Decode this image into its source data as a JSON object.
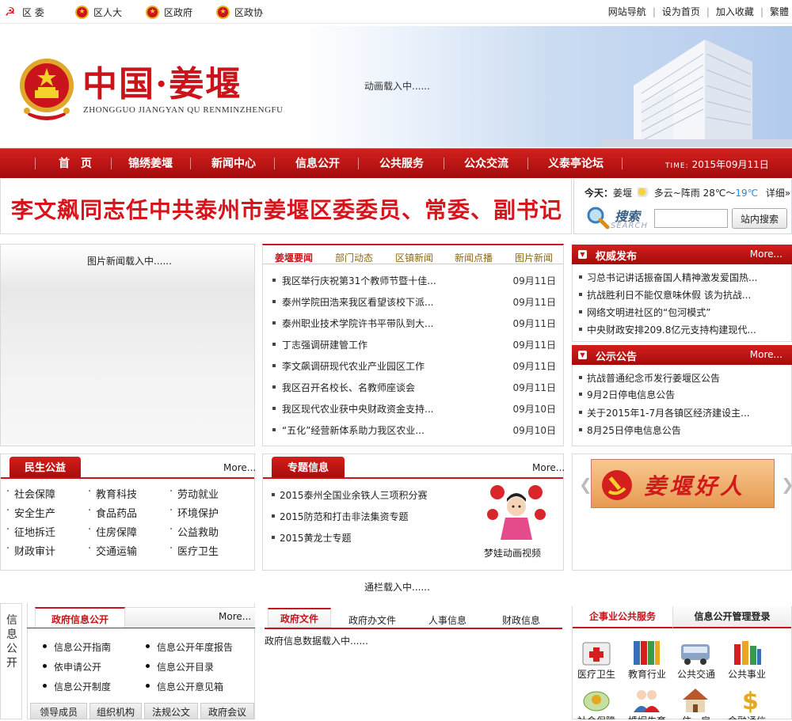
{
  "topbar": {
    "links_left": [
      "区 委",
      "区人大",
      "区政府",
      "区政协"
    ],
    "links_right": [
      "网站导航",
      "设为首页",
      "加入收藏",
      "繁體"
    ]
  },
  "header": {
    "title": "中国·姜堰",
    "subtitle": "ZHONGGUO JIANGYAN QU RENMINZHENGFU",
    "animation_status": "动画载入中......"
  },
  "nav": {
    "items": [
      "首　页",
      "锦绣姜堰",
      "新闻中心",
      "信息公开",
      "公共服务",
      "公众交流",
      "义泰亭论坛"
    ],
    "time_label": "TIME:",
    "time_value": "2015年09月11日"
  },
  "headline": "李文飙同志任中共泰州市姜堰区委委员、常委、副书记",
  "weather": {
    "prefix": "今天：",
    "city": "姜堰",
    "condition": "多云~阵雨",
    "temp_high": "28℃",
    "sep": "～",
    "temp_low": "19℃",
    "detail": "详细»"
  },
  "search": {
    "label": "搜索",
    "label_en": "SEARCH",
    "placeholder": "",
    "button": "站内搜索"
  },
  "photo_news": {
    "status": "图片新闻载入中......"
  },
  "news": {
    "tabs": [
      "姜堰要闻",
      "部门动态",
      "区镇新闻",
      "新闻点播",
      "图片新闻"
    ],
    "items": [
      {
        "title": "我区举行庆祝第31个教师节暨十佳...",
        "date": "09月11日"
      },
      {
        "title": "泰州学院田浩来我区看望该校下派...",
        "date": "09月11日"
      },
      {
        "title": "泰州职业技术学院许书平带队到大...",
        "date": "09月11日"
      },
      {
        "title": "丁志强调研建管工作",
        "date": "09月11日"
      },
      {
        "title": "李文飙调研现代农业产业园区工作",
        "date": "09月11日"
      },
      {
        "title": "我区召开名校长、名教师座谈会",
        "date": "09月11日"
      },
      {
        "title": "我区现代农业获中央财政资金支持...",
        "date": "09月10日"
      },
      {
        "title": "“五化”经营新体系助力我区农业...",
        "date": "09月10日"
      }
    ]
  },
  "authority": {
    "title": "权威发布",
    "more": "More...",
    "items": [
      "习总书记讲话振奋国人精神激发爱国热...",
      "抗战胜利日不能仅意味休假 该为抗战...",
      "网络文明进社区的“包河模式”",
      "中央财政安排209.8亿元支持构建现代..."
    ]
  },
  "notice": {
    "title": "公示公告",
    "more": "More...",
    "items": [
      "抗战普通纪念币发行姜堰区公告",
      "9月2日停电信息公告",
      "关于2015年1-7月各镇区经济建设主...",
      "8月25日停电信息公告"
    ]
  },
  "livelihood": {
    "title": "民生公益",
    "more": "More...",
    "items": [
      "社会保障",
      "教育科技",
      "劳动就业",
      "安全生产",
      "食品药品",
      "环境保护",
      "征地拆迁",
      "住房保障",
      "公益救助",
      "财政审计",
      "交通运输",
      "医疗卫生"
    ]
  },
  "topics": {
    "title": "专题信息",
    "more": "More...",
    "items": [
      "2015泰州全国业余铁人三项积分赛",
      "2015防范和打击非法集资专题",
      "2015黄龙士专题"
    ],
    "video_caption": "梦娃动画视频"
  },
  "good_people": {
    "text": "姜堰好人"
  },
  "banner_status": "通栏载入中......",
  "gov_info": {
    "side_label": "信息公开",
    "tab": "政府信息公开",
    "more": "More...",
    "items": [
      "信息公开指南",
      "信息公开年度报告",
      "依申请公开",
      "信息公开目录",
      "信息公开制度",
      "信息公开意见箱"
    ],
    "bottom_tabs": [
      "领导成员",
      "组织机构",
      "法规公文",
      "政府会议"
    ]
  },
  "gov_docs": {
    "tabs": [
      "政府文件",
      "政府办文件",
      "人事信息",
      "财政信息"
    ],
    "status": "政府信息数据载入中......"
  },
  "services": {
    "tabs": [
      "企事业公共服务",
      "信息公开管理登录"
    ],
    "items": [
      "医疗卫生",
      "教育行业",
      "公共交通",
      "公共事业",
      "社会保障",
      "婚姻生育",
      "住　房",
      "金融通信"
    ]
  },
  "colors": {
    "brand_red": "#c8141a",
    "nav_red": "#b8110f",
    "weather_blue": "#2b8ad6"
  }
}
